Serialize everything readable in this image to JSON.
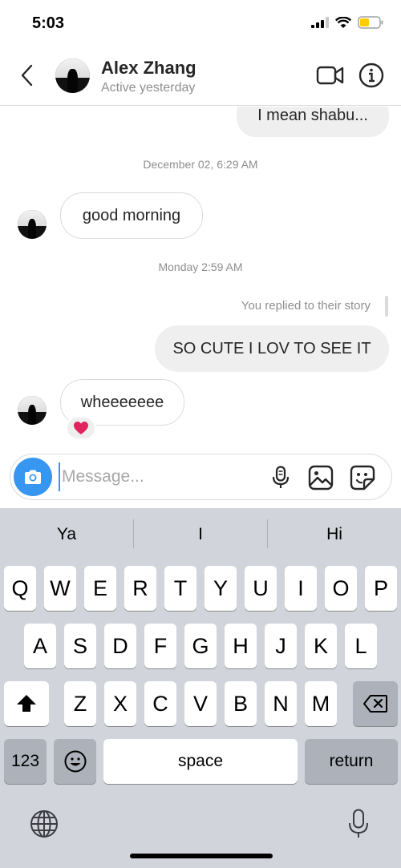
{
  "status_bar": {
    "time": "5:03"
  },
  "header": {
    "name": "Alex Zhang",
    "status": "Active yesterday"
  },
  "chat": {
    "messages": [
      {
        "type": "outgoing",
        "text": "I mean shabu..."
      },
      {
        "type": "timestamp",
        "text": "December 02, 6:29 AM"
      },
      {
        "type": "incoming",
        "text": "good morning"
      },
      {
        "type": "timestamp",
        "text": "Monday 2:59 AM"
      },
      {
        "type": "reply_note",
        "text": "You replied to their story"
      },
      {
        "type": "outgoing",
        "text": "SO CUTE I LOV TO SEE IT"
      },
      {
        "type": "incoming",
        "text": "wheeeeeee",
        "reaction": "❤️"
      }
    ]
  },
  "composer": {
    "placeholder": "Message..."
  },
  "keyboard": {
    "suggestions": [
      "Ya",
      "I",
      "Hi"
    ],
    "row1": [
      "Q",
      "W",
      "E",
      "R",
      "T",
      "Y",
      "U",
      "I",
      "O",
      "P"
    ],
    "row2": [
      "A",
      "S",
      "D",
      "F",
      "G",
      "H",
      "J",
      "K",
      "L"
    ],
    "row3": [
      "Z",
      "X",
      "C",
      "V",
      "B",
      "N",
      "M"
    ],
    "numbers_label": "123",
    "space_label": "space",
    "return_label": "return"
  },
  "colors": {
    "accent": "#3797f0",
    "bubble_out": "#efefef",
    "keyboard_bg": "#d1d4da",
    "heart": "#e0245e"
  }
}
